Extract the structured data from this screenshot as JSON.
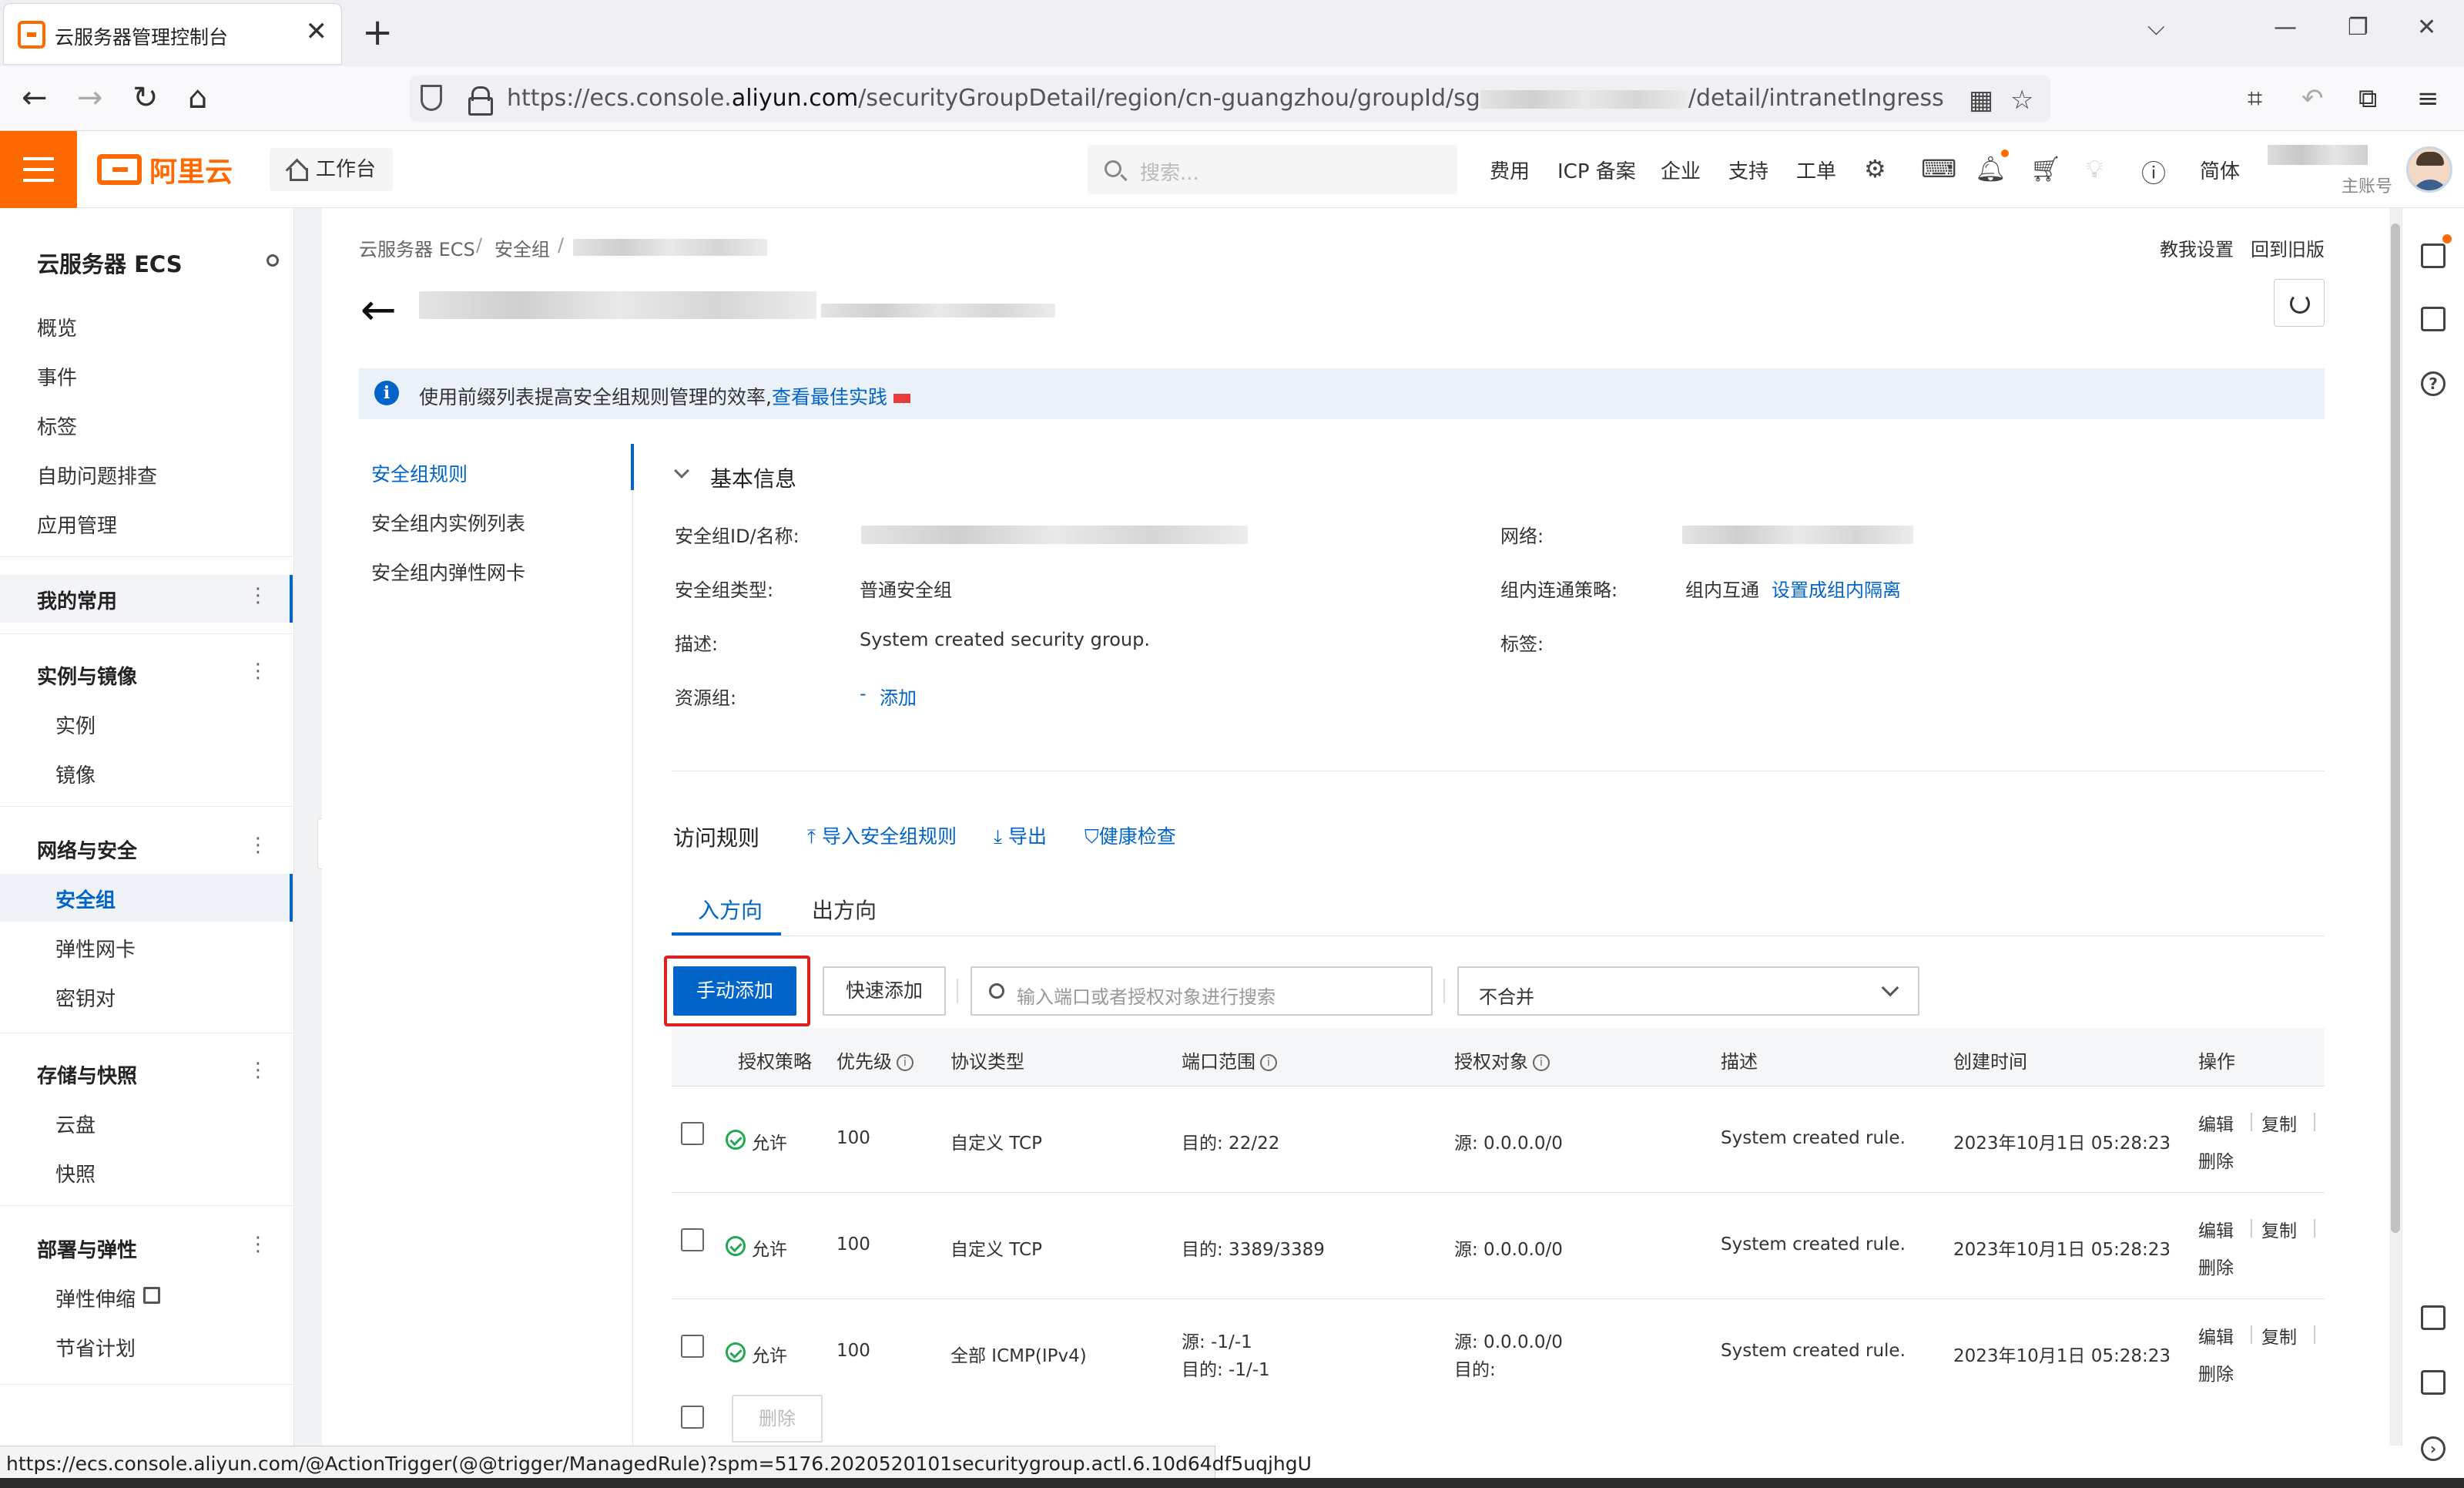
{
  "browser": {
    "tab_title": "云服务器管理控制台",
    "url_prefix": "https://ecs.console.",
    "url_domain": "aliyun.com",
    "url_path": "/securityGroupDetail/region/cn-guangzhou/groupId/sg",
    "url_suffix": "/detail/intranetIngress",
    "status_url": "https://ecs.console.aliyun.com/@ActionTrigger(@@trigger/ManagedRule)?spm=5176.2020520101securitygroup.actl.6.10d64df5uqjhgU"
  },
  "header": {
    "logo_text": "阿里云",
    "workbench": "工作台",
    "search_placeholder": "搜索...",
    "links": [
      "费用",
      "ICP 备案",
      "企业",
      "支持",
      "工单"
    ],
    "lang": "简体",
    "account_sub": "主账号"
  },
  "sidebar": {
    "title": "云服务器 ECS",
    "top_items": [
      "概览",
      "事件",
      "标签",
      "自助问题排查",
      "应用管理"
    ],
    "favorites": "我的常用",
    "group_instances": "实例与镜像",
    "instances_items": [
      "实例",
      "镜像"
    ],
    "group_network": "网络与安全",
    "network_items": [
      "安全组",
      "弹性网卡",
      "密钥对"
    ],
    "group_storage": "存储与快照",
    "storage_items": [
      "云盘",
      "快照"
    ],
    "group_deploy": "部署与弹性",
    "deploy_items": [
      "弹性伸缩",
      "节省计划"
    ]
  },
  "main": {
    "breadcrumb": [
      "云服务器 ECS",
      "安全组"
    ],
    "top_links": [
      "教我设置",
      "回到旧版"
    ],
    "notice_text": "使用前缀列表提高安全组规则管理的效率,",
    "notice_link": "查看最佳实践",
    "inner_nav": [
      "安全组规则",
      "安全组内实例列表",
      "安全组内弹性网卡"
    ],
    "basic_info_title": "基本信息",
    "fields": {
      "id_label": "安全组ID/名称:",
      "network_label": "网络:",
      "type_label": "安全组类型:",
      "type_value": "普通安全组",
      "policy_label": "组内连通策略:",
      "policy_value": "组内互通",
      "policy_link": "设置成组内隔离",
      "desc_label": "描述:",
      "desc_value": "System created security group.",
      "tag_label": "标签:",
      "rg_label": "资源组:",
      "rg_value": "-",
      "rg_link": "添加"
    },
    "access_rules_title": "访问规则",
    "access_actions": [
      "导入安全组规则",
      "导出",
      "健康检查"
    ],
    "tabs": [
      "入方向",
      "出方向"
    ],
    "btn_manual_add": "手动添加",
    "btn_quick_add": "快速添加",
    "rule_search_placeholder": "输入端口或者授权对象进行搜索",
    "merge_select": "不合并",
    "columns": [
      "授权策略",
      "优先级",
      "协议类型",
      "端口范围",
      "授权对象",
      "描述",
      "创建时间",
      "操作"
    ],
    "rows": [
      {
        "policy": "允许",
        "priority": "100",
        "protocol": "自定义 TCP",
        "port": "目的: 22/22",
        "port2": "",
        "target": "源: 0.0.0.0/0",
        "target2": "",
        "desc": "System created rule.",
        "time": "2023年10月1日 05:28:23"
      },
      {
        "policy": "允许",
        "priority": "100",
        "protocol": "自定义 TCP",
        "port": "目的: 3389/3389",
        "port2": "",
        "target": "源: 0.0.0.0/0",
        "target2": "",
        "desc": "System created rule.",
        "time": "2023年10月1日 05:28:23"
      },
      {
        "policy": "允许",
        "priority": "100",
        "protocol": "全部 ICMP(IPv4)",
        "port": "源: -1/-1",
        "port2": "目的: -1/-1",
        "target": "源: 0.0.0.0/0",
        "target2": "目的:",
        "desc": "System created rule.",
        "time": "2023年10月1日 05:28:23"
      }
    ],
    "op_edit": "编辑",
    "op_copy": "复制",
    "op_delete": "删除",
    "bulk_delete": "删除"
  }
}
